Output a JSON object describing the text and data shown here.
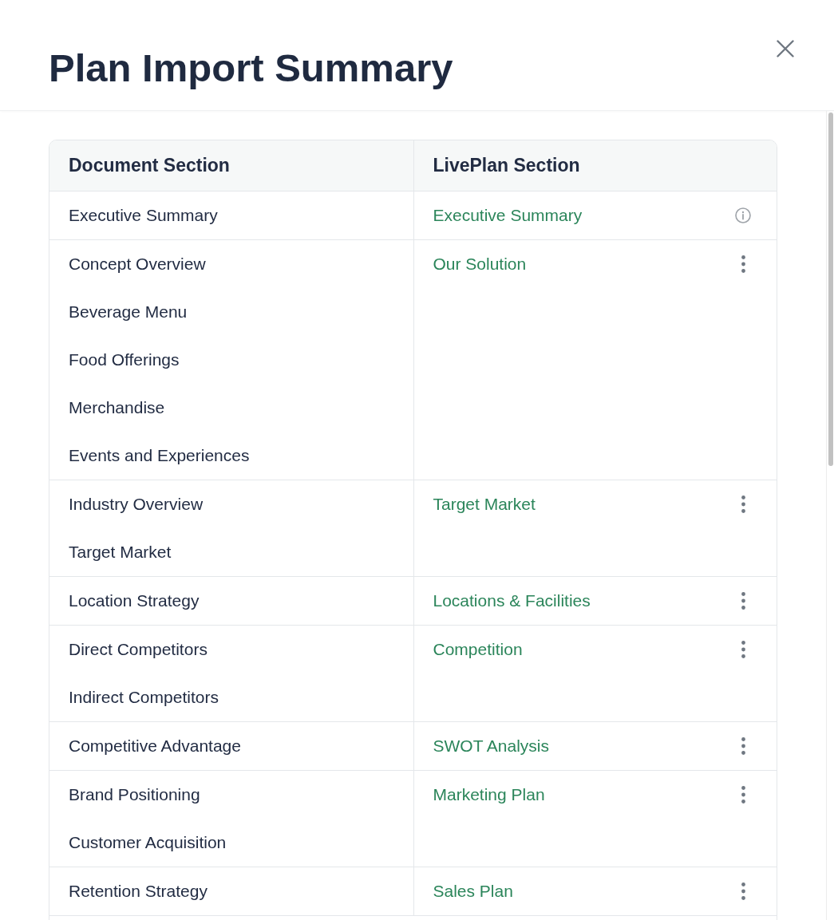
{
  "dialog": {
    "title": "Plan Import Summary"
  },
  "table": {
    "columns": [
      "Document Section",
      "LivePlan Section"
    ],
    "rows": [
      {
        "document_sections": [
          "Executive Summary"
        ],
        "liveplan_section": "Executive Summary",
        "kind": "info"
      },
      {
        "document_sections": [
          "Concept Overview",
          "Beverage Menu",
          "Food Offerings",
          "Merchandise",
          "Events and Experiences"
        ],
        "liveplan_section": "Our Solution",
        "kind": "menu"
      },
      {
        "document_sections": [
          "Industry Overview",
          "Target Market"
        ],
        "liveplan_section": "Target Market",
        "kind": "menu"
      },
      {
        "document_sections": [
          "Location Strategy"
        ],
        "liveplan_section": "Locations & Facilities",
        "kind": "menu"
      },
      {
        "document_sections": [
          "Direct Competitors",
          "Indirect Competitors"
        ],
        "liveplan_section": "Competition",
        "kind": "menu"
      },
      {
        "document_sections": [
          "Competitive Advantage"
        ],
        "liveplan_section": "SWOT Analysis",
        "kind": "menu"
      },
      {
        "document_sections": [
          "Brand Positioning",
          "Customer Acquisition"
        ],
        "liveplan_section": "Marketing Plan",
        "kind": "menu"
      },
      {
        "document_sections": [
          "Retention Strategy"
        ],
        "liveplan_section": "Sales Plan",
        "kind": "menu"
      }
    ]
  }
}
